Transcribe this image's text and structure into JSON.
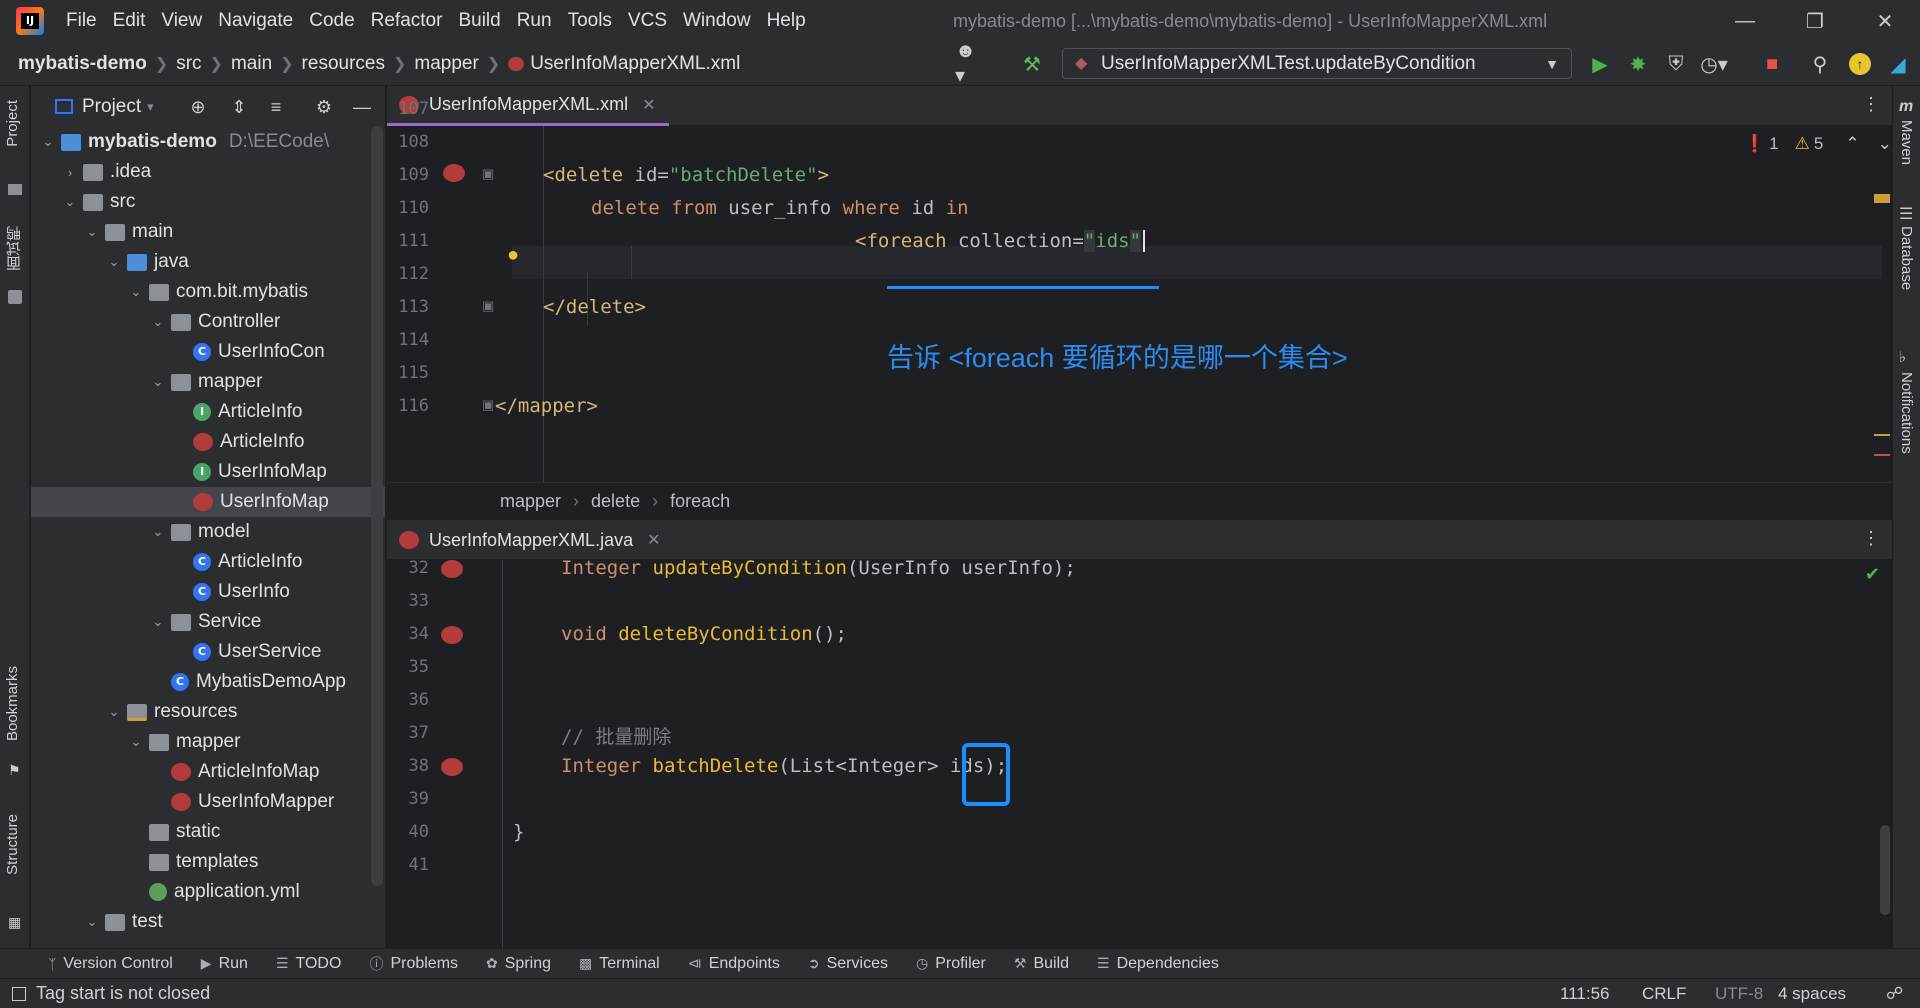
{
  "menu": [
    "File",
    "Edit",
    "View",
    "Navigate",
    "Code",
    "Refactor",
    "Build",
    "Run",
    "Tools",
    "VCS",
    "Window",
    "Help"
  ],
  "window_title": "mybatis-demo [...\\mybatis-demo\\mybatis-demo] - UserInfoMapperXML.xml",
  "breadcrumbs": [
    "mybatis-demo",
    "src",
    "main",
    "resources",
    "mapper",
    "UserInfoMapperXML.xml"
  ],
  "run_config": "UserInfoMapperXMLTest.updateByCondition",
  "project_panel": {
    "title": "Project",
    "root_path": "D:\\EECode\\",
    "tree": [
      {
        "label": "mybatis-demo",
        "arrow": "v",
        "icon": "module"
      },
      {
        "label": ".idea",
        "arrow": ">",
        "icon": "folder"
      },
      {
        "label": "src",
        "arrow": "v",
        "icon": "folder"
      },
      {
        "label": "main",
        "arrow": "v",
        "icon": "folder"
      },
      {
        "label": "java",
        "arrow": "v",
        "icon": "folder-blue"
      },
      {
        "label": "com.bit.mybatis",
        "arrow": "v",
        "icon": "package"
      },
      {
        "label": "Controller",
        "arrow": "v",
        "icon": "package"
      },
      {
        "label": "UserInfoCon",
        "arrow": "",
        "icon": "class"
      },
      {
        "label": "mapper",
        "arrow": "v",
        "icon": "package"
      },
      {
        "label": "ArticleInfo",
        "arrow": "",
        "icon": "interface"
      },
      {
        "label": "ArticleInfo",
        "arrow": "",
        "icon": "mybatis"
      },
      {
        "label": "UserInfoMap",
        "arrow": "",
        "icon": "interface"
      },
      {
        "label": "UserInfoMap",
        "arrow": "",
        "icon": "mybatis"
      },
      {
        "label": "model",
        "arrow": "v",
        "icon": "package"
      },
      {
        "label": "ArticleInfo",
        "arrow": "",
        "icon": "class"
      },
      {
        "label": "UserInfo",
        "arrow": "",
        "icon": "class"
      },
      {
        "label": "Service",
        "arrow": "v",
        "icon": "package"
      },
      {
        "label": "UserService",
        "arrow": "",
        "icon": "class"
      },
      {
        "label": "MybatisDemoApp",
        "arrow": "",
        "icon": "class"
      },
      {
        "label": "resources",
        "arrow": "v",
        "icon": "folder-res"
      },
      {
        "label": "mapper",
        "arrow": "v",
        "icon": "folder"
      },
      {
        "label": "ArticleInfoMap",
        "arrow": "",
        "icon": "mybatis"
      },
      {
        "label": "UserInfoMapper",
        "arrow": "",
        "icon": "mybatis"
      },
      {
        "label": "static",
        "arrow": "",
        "icon": "folder"
      },
      {
        "label": "templates",
        "arrow": "",
        "icon": "folder"
      },
      {
        "label": "application.yml",
        "arrow": "",
        "icon": "yml"
      },
      {
        "label": "test",
        "arrow": "v",
        "icon": "folder"
      }
    ]
  },
  "left_stripe": {
    "project": "Project",
    "chinese": "面试鸭",
    "bookmarks": "Bookmarks",
    "structure": "Structure"
  },
  "right_stripe": {
    "maven": "Maven",
    "database": "Database",
    "notifications": "Notifications"
  },
  "editor_top": {
    "tab": "UserInfoMapperXML.xml",
    "errors": "1",
    "warnings": "5",
    "lines": [
      {
        "n": "107",
        "code": ""
      },
      {
        "n": "108",
        "code": ""
      },
      {
        "n": "109",
        "code": "<delete id=\"batchDelete\">"
      },
      {
        "n": "110",
        "code": "delete from user_info where id in"
      },
      {
        "n": "111",
        "code": "<foreach collection=\"ids\""
      },
      {
        "n": "112",
        "code": ""
      },
      {
        "n": "113",
        "code": "</delete>"
      },
      {
        "n": "114",
        "code": ""
      },
      {
        "n": "115",
        "code": ""
      },
      {
        "n": "116",
        "code": "</mapper>"
      }
    ],
    "annotation": "告诉 <foreach 要循环的是哪一个集合>"
  },
  "editor_breadcrumb": [
    "mapper",
    "delete",
    "foreach"
  ],
  "editor_bottom": {
    "tab": "UserInfoMapperXML.java",
    "lines": [
      {
        "n": "32",
        "code": "Integer updateByCondition(UserInfo userInfo);"
      },
      {
        "n": "33",
        "code": ""
      },
      {
        "n": "34",
        "code": "void deleteByCondition();"
      },
      {
        "n": "35",
        "code": ""
      },
      {
        "n": "36",
        "code": ""
      },
      {
        "n": "37",
        "code": "// 批量删除"
      },
      {
        "n": "38",
        "code": "Integer batchDelete(List<Integer> ids);"
      },
      {
        "n": "39",
        "code": ""
      },
      {
        "n": "40",
        "code": "}"
      },
      {
        "n": "41",
        "code": ""
      }
    ]
  },
  "tool_windows": [
    "Version Control",
    "Run",
    "TODO",
    "Problems",
    "Spring",
    "Terminal",
    "Endpoints",
    "Services",
    "Profiler",
    "Build",
    "Dependencies"
  ],
  "status": {
    "message": "Tag start is not closed",
    "position": "111:56",
    "line_sep": "CRLF",
    "encoding": "UTF-8",
    "indent": "4 spaces"
  }
}
